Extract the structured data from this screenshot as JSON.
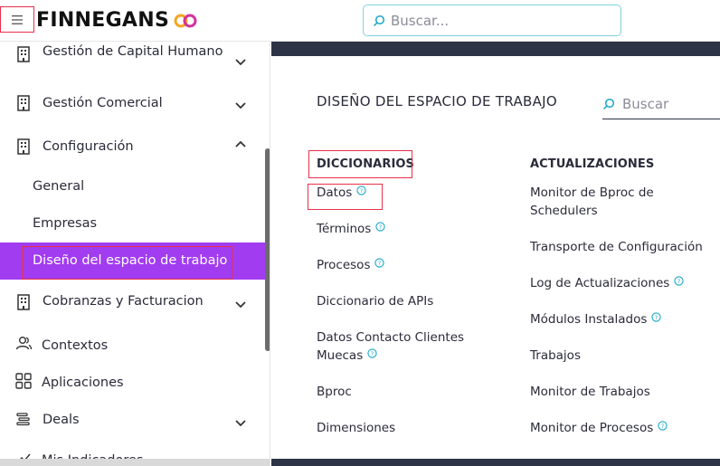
{
  "header": {
    "logo_text": "FINNEGANS",
    "search_placeholder": "Buscar..."
  },
  "sidebar": {
    "items": [
      {
        "label": "Gestión de Capital Humano",
        "icon": "building-icon",
        "expanded": false
      },
      {
        "label": "Gestión Comercial",
        "icon": "building-icon",
        "expanded": false
      },
      {
        "label": "Configuración",
        "icon": "building-icon",
        "expanded": true
      },
      {
        "label": "Cobranzas y Facturacion",
        "icon": "building-icon",
        "expanded": false
      },
      {
        "label": "Contextos",
        "icon": "users-icon"
      },
      {
        "label": "Aplicaciones",
        "icon": "grid-icon"
      },
      {
        "label": "Deals",
        "icon": "stack-icon",
        "expanded": false
      },
      {
        "label": "Mis Indicadores",
        "icon": "chart-icon"
      }
    ],
    "sub_items": [
      "General",
      "Empresas",
      "Diseño del espacio de trabajo"
    ],
    "active_sub_item": "Diseño del espacio de trabajo"
  },
  "main": {
    "title": "DISEÑO DEL ESPACIO DE TRABAJO",
    "search_placeholder": "Buscar",
    "columns": [
      {
        "heading": "DICCIONARIOS",
        "links": [
          {
            "label": "Datos",
            "help": true
          },
          {
            "label": "Términos",
            "help": true
          },
          {
            "label": "Procesos",
            "help": true
          },
          {
            "label": "Diccionario de APIs",
            "help": false
          },
          {
            "label": "Datos Contacto Clientes Muecas",
            "help": true
          },
          {
            "label": "Bproc",
            "help": false
          },
          {
            "label": "Dimensiones",
            "help": false
          }
        ]
      },
      {
        "heading": "ACTUALIZACIONES",
        "links": [
          {
            "label": "Monitor de Bproc de Schedulers",
            "help": false
          },
          {
            "label": "Transporte de Configuración",
            "help": false
          },
          {
            "label": "Log de Actualizaciones",
            "help": true
          },
          {
            "label": "Módulos Instalados",
            "help": true
          },
          {
            "label": "Trabajos",
            "help": false
          },
          {
            "label": "Monitor de Trabajos",
            "help": false
          },
          {
            "label": "Monitor de Procesos",
            "help": true
          }
        ]
      }
    ]
  },
  "colors": {
    "accent_purple": "#a23cf0",
    "highlight_red": "#e8314a",
    "search_border": "#7fd3e0",
    "dark_band": "#2d3446",
    "help_icon": "#19a6c8",
    "logo_orange": "#f5a623",
    "logo_magenta": "#d3329e"
  }
}
